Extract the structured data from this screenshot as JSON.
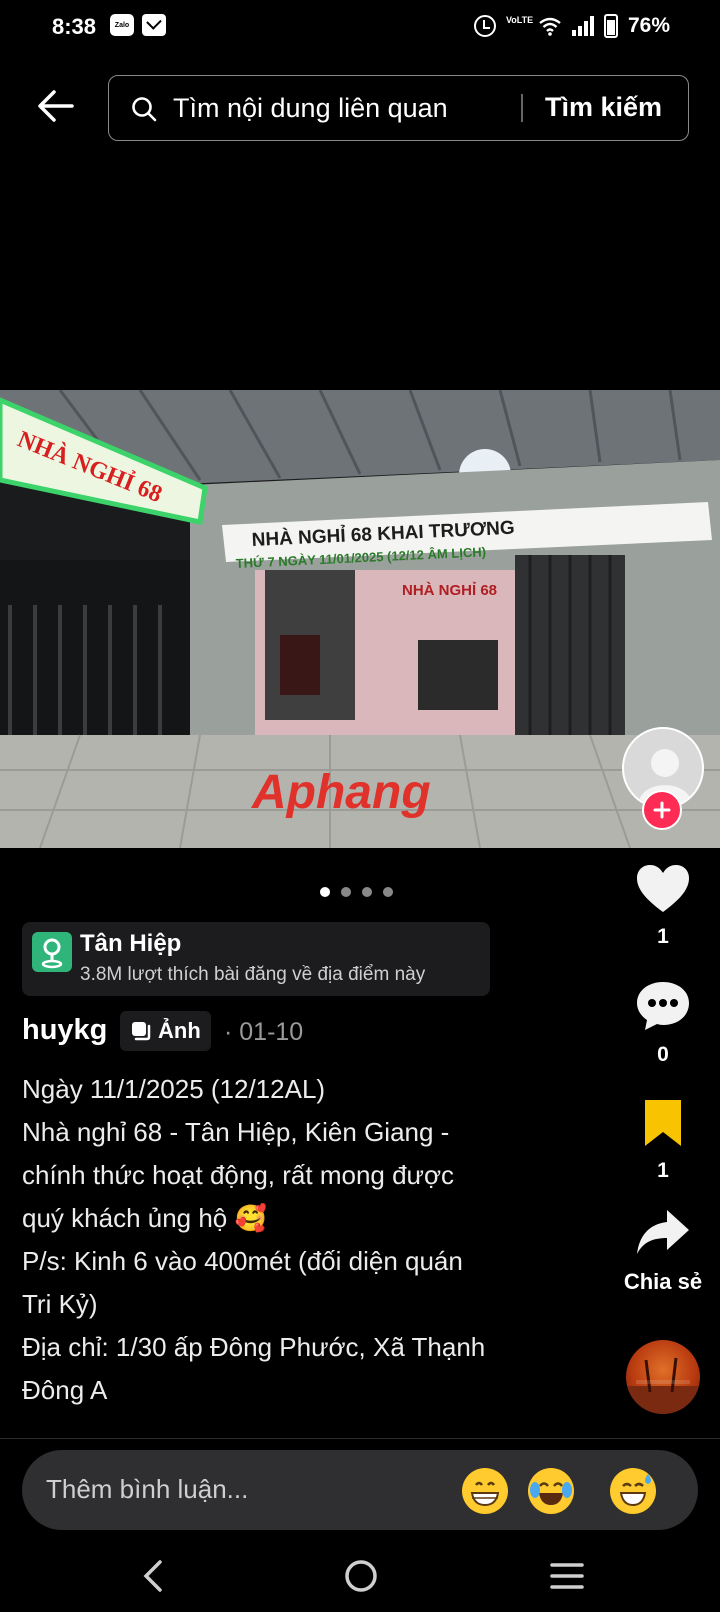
{
  "status_bar": {
    "time": "8:38",
    "zalo_label": "Zalo",
    "lte_label": "VoLTE",
    "battery": "76%"
  },
  "search": {
    "placeholder": "Tìm nội dung liên quan",
    "button_label": "Tìm kiếm"
  },
  "photo": {
    "sign_main": "NHÀ NGHỈ 68",
    "banner_title": "NHÀ NGHỈ 68 KHAI TRƯƠNG",
    "banner_sub": "THỨ 7 NGÀY 11/01/2025 (12/12 ÂM LỊCH)",
    "inner_sign": "NHÀ NGHỈ 68",
    "watermark": "Aphang"
  },
  "pager": {
    "count": 4,
    "active_index": 0
  },
  "location": {
    "name": "Tân Hiệp",
    "subtitle": "3.8M lượt thích bài đăng về địa điểm này"
  },
  "post": {
    "author": "huykg",
    "type_label": "Ảnh",
    "date": "· 01-10",
    "caption_lines": [
      "Ngày 11/1/2025 (12/12AL)",
      "Nhà nghỉ 68 - Tân Hiệp, Kiên Giang -",
      "chính thức hoạt động, rất mong được",
      "quý khách ủng hộ 🥰",
      "P/s: Kinh 6 vào 400mét (đối diện quán",
      "Tri Kỷ)",
      "Địa chỉ: 1/30 ấp Đông Phước, Xã Thạnh",
      "Đông A"
    ]
  },
  "actions": {
    "likes": "1",
    "comments": "0",
    "saves": "1",
    "share_label": "Chia sẻ"
  },
  "comment": {
    "placeholder": "Thêm bình luận..."
  },
  "colors": {
    "background": "#000000",
    "follow": "#fe2c55",
    "bookmark": "#f8c301",
    "location_icon": "#2fb57a"
  }
}
